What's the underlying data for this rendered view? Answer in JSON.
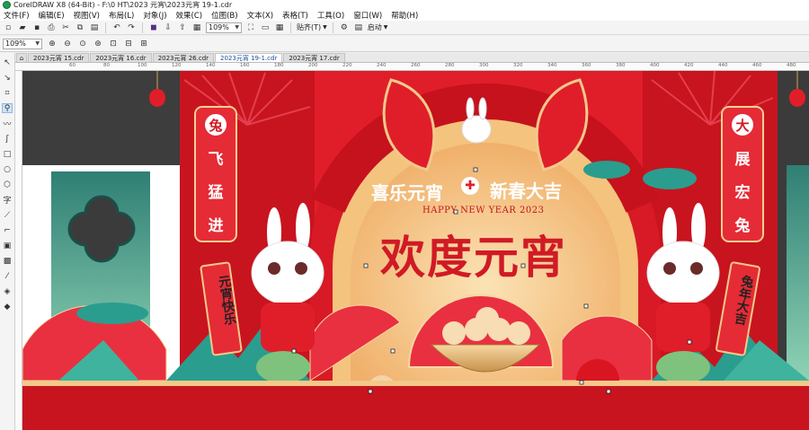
{
  "window": {
    "title": "CorelDRAW X8 (64-Bit) - F:\\0 HT\\2023 元宵\\2023元宵 19-1.cdr"
  },
  "menu": [
    "文件(F)",
    "编辑(E)",
    "视图(V)",
    "布局(L)",
    "对象(J)",
    "效果(C)",
    "位图(B)",
    "文本(X)",
    "表格(T)",
    "工具(O)",
    "窗口(W)",
    "帮助(H)"
  ],
  "toolbar": {
    "zoom_value": "109%",
    "snap_label": "贴齐(T)",
    "launch_label": "启动"
  },
  "property_bar": {
    "zoom_value": "109%"
  },
  "tabs": [
    "2023元宵 15.cdr",
    "2023元宵 16.cdr",
    "2023元宵 26.cdr",
    "2023元宵 19-1.cdr",
    "2023元宵 17.cdr"
  ],
  "active_tab": "2023元宵 19-1.cdr",
  "ruler": {
    "marks": [
      "60",
      "80",
      "100",
      "120",
      "140",
      "160",
      "180",
      "200",
      "220",
      "240",
      "260",
      "280",
      "300",
      "320",
      "340",
      "360",
      "380",
      "400",
      "420",
      "440",
      "460",
      "480"
    ]
  },
  "artwork": {
    "left_banner": [
      "兔",
      "飞",
      "猛",
      "进"
    ],
    "right_banner": [
      "大",
      "展",
      "宏",
      "兔"
    ],
    "arch_text_left": "喜乐元宵",
    "arch_text_right": "新春大吉",
    "english_line": "HAPPY NEW YEAR 2023",
    "main_title": "欢度元宵",
    "scroll_left": "元宵快乐",
    "scroll_right": "兔年大吉"
  },
  "colors": {
    "red": "#e01e2a",
    "dark_red": "#b3101c",
    "gold": "#f3c98a",
    "teal": "#2a9d8f",
    "dark_gray": "#3c3c3c"
  }
}
